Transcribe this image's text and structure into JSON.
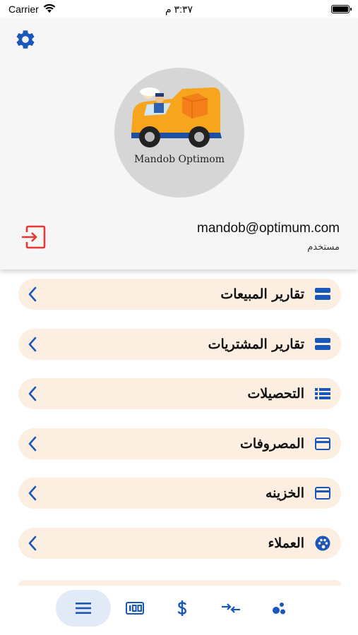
{
  "status_bar": {
    "carrier": "Carrier",
    "time": "٣:٣٧ م"
  },
  "header": {
    "avatar_caption": "Mandob Optimom",
    "email": "mandob@optimum.com",
    "role": "مستخدم"
  },
  "menu": [
    {
      "label": "تقارير المبيعات",
      "icon": "storage-icon"
    },
    {
      "label": "تقارير المشتريات",
      "icon": "storage-icon"
    },
    {
      "label": "التحصيلات",
      "icon": "list-icon"
    },
    {
      "label": "المصروفات",
      "icon": "credit-card-icon"
    },
    {
      "label": "الخزينه",
      "icon": "credit-card-icon"
    },
    {
      "label": "العملاء",
      "icon": "palette-icon"
    }
  ],
  "bottom_nav": [
    {
      "icon": "menu-icon",
      "active": true
    },
    {
      "icon": "counter-icon",
      "active": false
    },
    {
      "icon": "dollar-icon",
      "active": false
    },
    {
      "icon": "compare-arrows-icon",
      "active": false
    },
    {
      "icon": "bubbles-icon",
      "active": false
    }
  ],
  "colors": {
    "accent": "#1957b8",
    "logout": "#e53935",
    "item_bg": "#fdeee2",
    "header_bg": "#f6f6f6"
  }
}
